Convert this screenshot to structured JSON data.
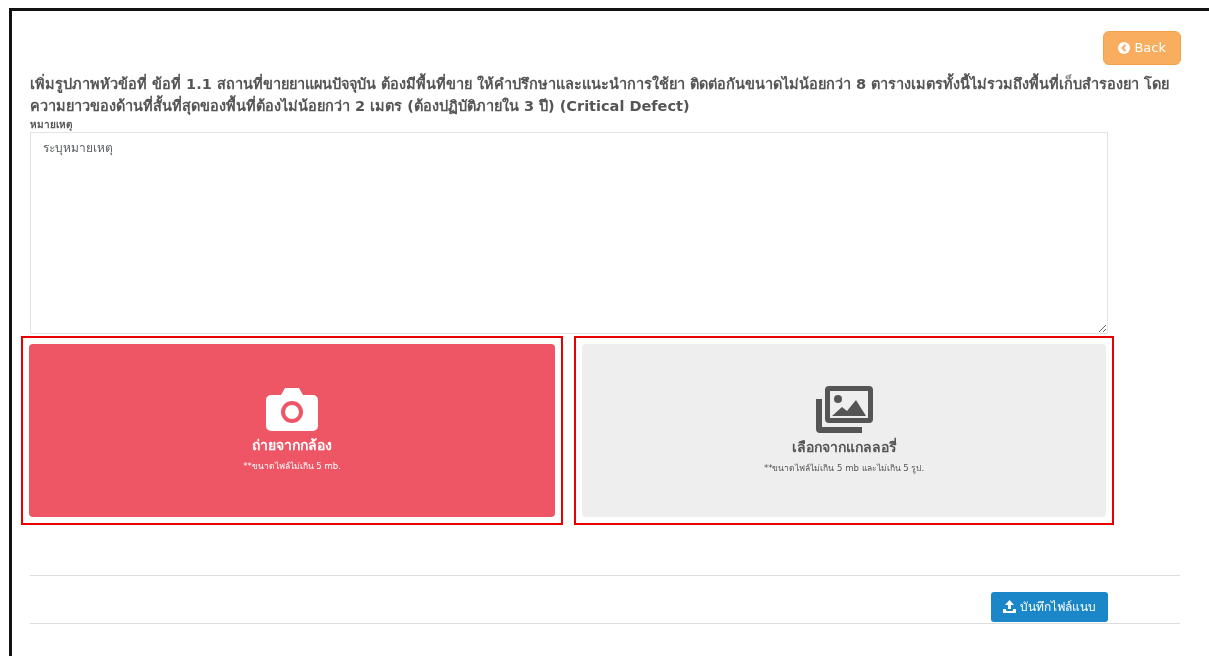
{
  "back_button": {
    "label": "Back"
  },
  "heading": "เพิ่มรูปภาพหัวข้อที่ ข้อที่ 1.1 สถานที่ขายยาแผนปัจจุบัน ต้องมีพื้นที่ขาย ให้คำปรึกษาและแนะนำการใช้ยา ติดต่อกันขนาดไม่น้อยกว่า 8 ตารางเมตรทั้งนี้ไม่รวมถึงพื้นที่เก็บสำรองยา โดยความยาวของด้านที่สั้นที่สุดของพื้นที่ต้องไม่น้อยกว่า 2 เมตร (ต้องปฏิบัติภายใน 3 ปี) (Critical Defect)",
  "remark": {
    "label": "หมายเหตุ",
    "placeholder": "ระบุหมายเหตุ"
  },
  "upload_options": [
    {
      "kind": "camera",
      "title": "ถ่ายจากกล้อง",
      "note": "**ขนาดไฟล์ไม่เกิน 5 mb.",
      "highlighted": true
    },
    {
      "kind": "gallery",
      "title": "เลือกจากแกลลอรี่",
      "note": "**ขนาดไฟล์ไม่เกิน 5 mb และไม่เกิน 5 รูป.",
      "highlighted": true
    }
  ],
  "save_button": {
    "label": "บันทึกไฟล์แนบ"
  }
}
